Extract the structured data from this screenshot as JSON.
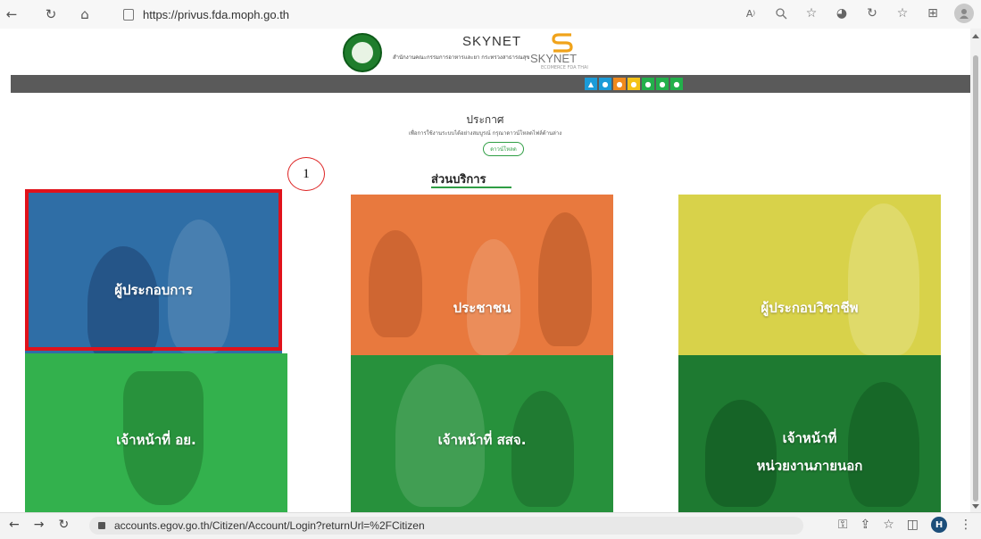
{
  "browser_top": {
    "url": "https://privus.fda.moph.go.th",
    "back_icon": "←",
    "reload_icon": "↻",
    "home_icon": "⌂",
    "right_icons": [
      "Aʸ",
      "🔍",
      "☆",
      "◕",
      "↻",
      "☆",
      "⊞"
    ]
  },
  "header": {
    "title": "SKYNET",
    "subtitle": "สำนักงานคณะกรรมการอาหารและยา กระทรวงสาธารณสุข",
    "logo_text": "SKYNET",
    "logo_sub": "ECOMERCE FDA THAI"
  },
  "navbar": {
    "icons": [
      {
        "color": "#1b9bd8",
        "glyph": "▲"
      },
      {
        "color": "#1b9bd8",
        "glyph": "●"
      },
      {
        "color": "#f08a1d",
        "glyph": "●"
      },
      {
        "color": "#f5c316",
        "glyph": "●"
      },
      {
        "color": "#23b04b",
        "glyph": "●"
      },
      {
        "color": "#23b04b",
        "glyph": "●"
      },
      {
        "color": "#23b04b",
        "glyph": "●"
      }
    ]
  },
  "announcement": {
    "title": "ประกาศ",
    "subtitle": "เพื่อการใช้งานระบบได้อย่างสมบูรณ์ กรุณาดาวน์โหลดไฟล์ด้านล่าง",
    "download_label": "ดาวน์โหลด"
  },
  "services": {
    "title": "ส่วนบริการ",
    "tiles": [
      {
        "label": "ผู้ประกอบการ",
        "color": "#2f6ea6"
      },
      {
        "label": "ประชาชน",
        "color": "#e8793e"
      },
      {
        "label": "ผู้ประกอบวิชาชีพ",
        "color": "#d8d24a"
      },
      {
        "label": "เจ้าหน้าที่ อย.",
        "color": "#33b14d"
      },
      {
        "label": "เจ้าหน้าที่ สสจ.",
        "color": "#27913c"
      },
      {
        "label": "เจ้าหน้าที่",
        "label2": "หน่วยงานภายนอก",
        "color": "#1e7a31"
      }
    ]
  },
  "annotation": {
    "number": "1"
  },
  "browser_bottom": {
    "url": "accounts.egov.go.th/Citizen/Account/Login?returnUrl=%2FCitizen",
    "avatar_letter": "H"
  }
}
